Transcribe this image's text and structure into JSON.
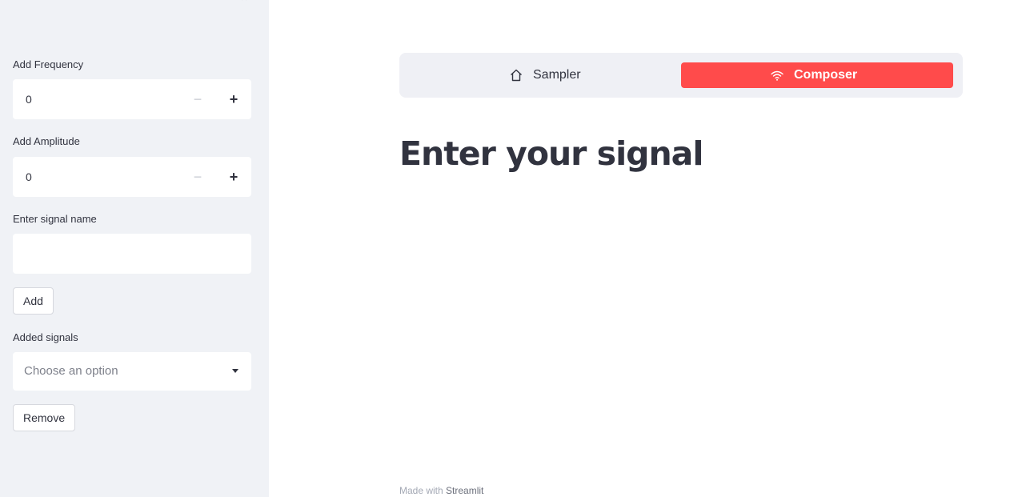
{
  "sidebar": {
    "frequency": {
      "label": "Add Frequency",
      "value": "0",
      "minus": "−",
      "plus": "+"
    },
    "amplitude": {
      "label": "Add Amplitude",
      "value": "0",
      "minus": "−",
      "plus": "+"
    },
    "signal_name": {
      "label": "Enter signal name",
      "value": ""
    },
    "add_button": "Add",
    "added_signals": {
      "label": "Added signals",
      "placeholder": "Choose an option"
    },
    "remove_button": "Remove",
    "close_glyph": "×"
  },
  "nav": {
    "items": [
      {
        "label": "Sampler",
        "icon": "house-icon",
        "active": false
      },
      {
        "label": "Composer",
        "icon": "wifi-icon",
        "active": true
      }
    ],
    "active_color": "#ff4b4b"
  },
  "main": {
    "title": "Enter your signal"
  },
  "footer": {
    "prefix": "Made with ",
    "link": "Streamlit"
  }
}
